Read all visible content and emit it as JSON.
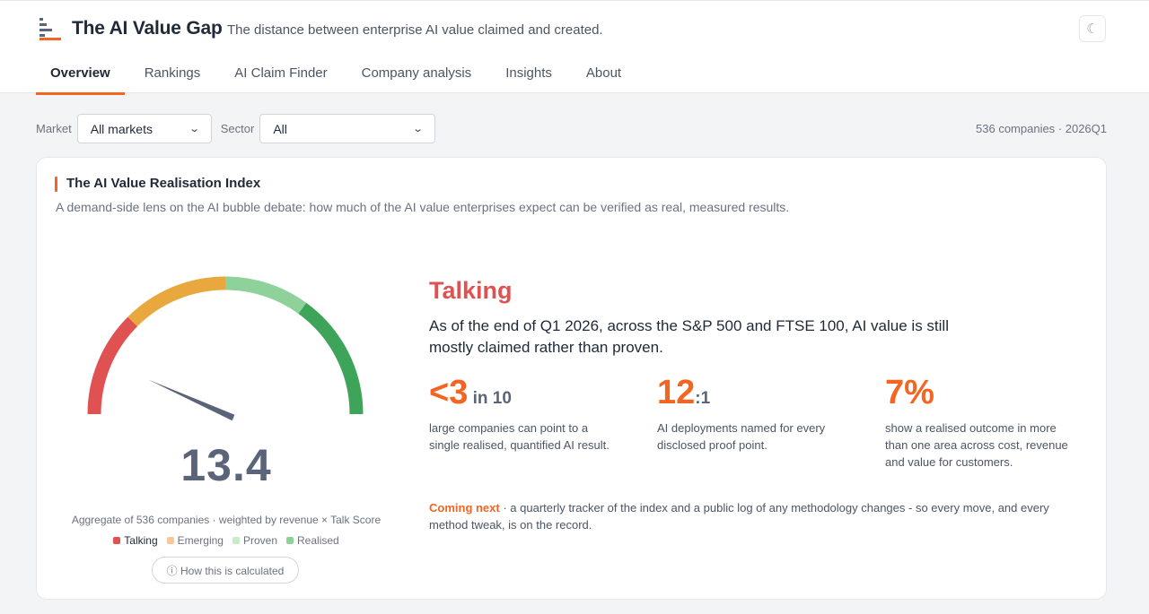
{
  "header": {
    "title": "The AI Value Gap",
    "subtitle": "The distance between enterprise AI value claimed and created.",
    "theme_toggle_icon": "☾"
  },
  "tabs": [
    {
      "label": "Overview",
      "active": true
    },
    {
      "label": "Rankings",
      "active": false
    },
    {
      "label": "AI Claim Finder",
      "active": false
    },
    {
      "label": "Company analysis",
      "active": false
    },
    {
      "label": "Insights",
      "active": false
    },
    {
      "label": "About",
      "active": false
    }
  ],
  "filters": {
    "market_label": "Market",
    "market_value": "All markets",
    "sector_label": "Sector",
    "sector_value": "All",
    "meta": "536 companies · 2026Q1"
  },
  "card": {
    "title": "The AI Value Realisation Index",
    "description": "A demand-side lens on the AI bubble debate: how much of the AI value enterprises expect can be verified as real, measured results.",
    "score": "13.4",
    "aggregate": "Aggregate of 536 companies · weighted by revenue × Talk Score",
    "legend": [
      {
        "label": "Talking",
        "color": "#e05252",
        "active": true
      },
      {
        "label": "Emerging",
        "color": "#f5c99a",
        "active": false
      },
      {
        "label": "Proven",
        "color": "#c8ecc8",
        "active": false
      },
      {
        "label": "Realised",
        "color": "#8fd19a",
        "active": false
      }
    ],
    "how_label": "ⓘ How this is calculated",
    "status": "Talking",
    "status_text": "As of the end of Q1 2026, across the S&P 500 and FTSE 100, AI value is still mostly claimed rather than proven.",
    "stats": [
      {
        "value": "<3",
        "suffix": " in 10",
        "desc": "large companies can point to a single realised, quantified AI result."
      },
      {
        "value": "12",
        "suffix": ":1",
        "desc": "AI deployments named for every disclosed proof point."
      },
      {
        "value": "7%",
        "suffix": "",
        "desc": "show a realised outcome in more than one area across cost, revenue and value for customers."
      }
    ],
    "coming_label": "Coming next",
    "coming_text": " · a quarterly tracker of the index and a public log of any methodology changes - so every move, and every method tweak, is on the record."
  },
  "gauge": {
    "min": 0,
    "max": 100,
    "value": 13.4,
    "bands": [
      {
        "name": "Talking",
        "from": 0,
        "to": 25,
        "color": "#e05252"
      },
      {
        "name": "Emerging",
        "from": 25,
        "to": 50,
        "color": "#e8a83e"
      },
      {
        "name": "Proven",
        "from": 50,
        "to": 70,
        "color": "#8fd19a"
      },
      {
        "name": "Realised",
        "from": 70,
        "to": 100,
        "color": "#3da45a"
      }
    ],
    "needle_color": "#5b6478"
  },
  "colors": {
    "accent": "#f26522",
    "talking": "#e05252"
  }
}
